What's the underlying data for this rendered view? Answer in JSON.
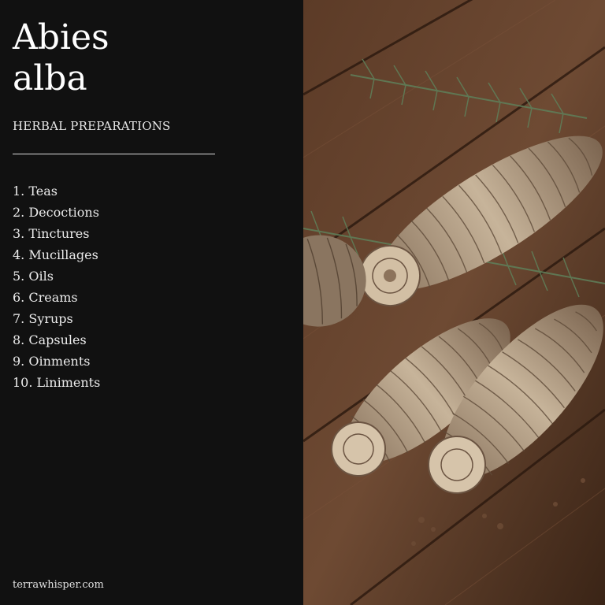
{
  "title_line1": "Abies",
  "title_line2": "alba",
  "subtitle": "HERBAL PREPARATIONS",
  "preparations": [
    "1. Teas",
    "2. Decoctions",
    "3. Tinctures",
    "4. Mucillages",
    "5. Oils",
    "6. Creams",
    "7. Syrups",
    "8. Capsules",
    "9. Oinments",
    "10. Liniments"
  ],
  "footer": "terrawhisper.com",
  "colors": {
    "panel_background": "#111111",
    "text": "#ffffff",
    "wood": "#5a3a26",
    "needles": "#4f6b4a",
    "cone": "#b9a58c"
  }
}
